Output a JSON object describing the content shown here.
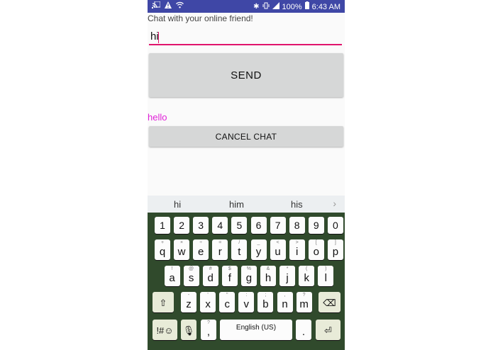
{
  "status_bar": {
    "left_icons": [
      "cast-icon",
      "warning-icon",
      "wifi-icon"
    ],
    "bluetooth": "✱",
    "battery_percent": "100%",
    "time": "6:43 AM"
  },
  "chat": {
    "prompt": "Chat with your online friend!",
    "input_value": "hi",
    "send_label": "SEND",
    "reply_text": "hello",
    "cancel_label": "CANCEL CHAT"
  },
  "keyboard": {
    "suggestions": [
      "hi",
      "him",
      "his"
    ],
    "numbers": [
      "1",
      "2",
      "3",
      "4",
      "5",
      "6",
      "7",
      "8",
      "9",
      "0"
    ],
    "row1": [
      {
        "k": "q",
        "h": "+"
      },
      {
        "k": "w",
        "h": "×"
      },
      {
        "k": "e",
        "h": "÷"
      },
      {
        "k": "r",
        "h": "="
      },
      {
        "k": "t",
        "h": "/"
      },
      {
        "k": "y",
        "h": "_"
      },
      {
        "k": "u",
        "h": "<"
      },
      {
        "k": "i",
        "h": ">"
      },
      {
        "k": "o",
        "h": "["
      },
      {
        "k": "p",
        "h": "]"
      }
    ],
    "row2": [
      {
        "k": "a",
        "h": "!"
      },
      {
        "k": "s",
        "h": "@"
      },
      {
        "k": "d",
        "h": "#"
      },
      {
        "k": "f",
        "h": "$"
      },
      {
        "k": "g",
        "h": "%"
      },
      {
        "k": "h",
        "h": "&"
      },
      {
        "k": "j",
        "h": "*"
      },
      {
        "k": "k",
        "h": "("
      },
      {
        "k": "l",
        "h": ")"
      }
    ],
    "row3": [
      {
        "k": "z",
        "h": "-"
      },
      {
        "k": "x",
        "h": "'"
      },
      {
        "k": "c",
        "h": "\""
      },
      {
        "k": "v",
        "h": ":"
      },
      {
        "k": "b",
        "h": ";"
      },
      {
        "k": "n",
        "h": ","
      },
      {
        "k": "m",
        "h": "?"
      }
    ],
    "shift_icon": "⇧",
    "backspace_icon": "⌫",
    "symbols_label": "!#☺",
    "mic_icon": "🎙",
    "comma": ",",
    "comma_hint": "?",
    "space_label": "English (US)",
    "period": ".",
    "enter_icon": "⏎",
    "colors": {
      "keyboard_bg": "#304a2c",
      "accent": "#e0136c",
      "reply": "#e020d8"
    }
  }
}
